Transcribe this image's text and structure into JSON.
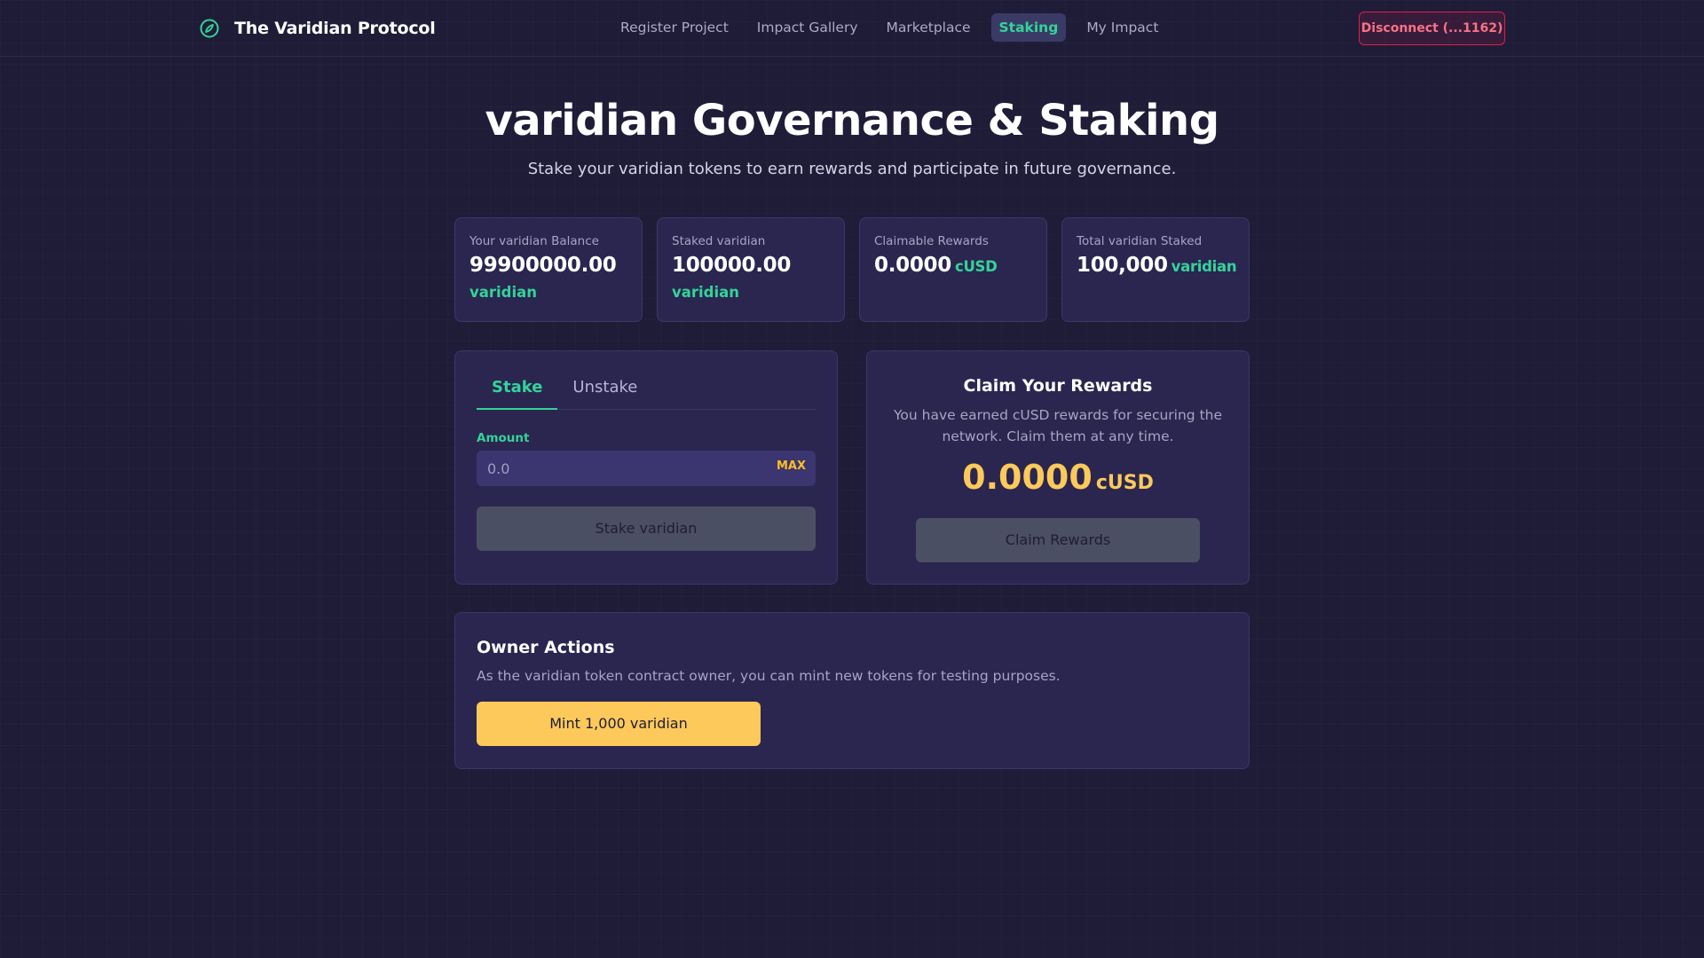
{
  "header": {
    "brand_icon": "leaf-circle-icon",
    "brand_title": "The Varidian Protocol",
    "nav": [
      {
        "label": "Register Project",
        "active": false
      },
      {
        "label": "Impact Gallery",
        "active": false
      },
      {
        "label": "Marketplace",
        "active": false
      },
      {
        "label": "Staking",
        "active": true
      },
      {
        "label": "My Impact",
        "active": false
      }
    ],
    "disconnect_label": "Disconnect (...1162)"
  },
  "hero": {
    "title": "varidian Governance & Staking",
    "subtitle": "Stake your varidian tokens to earn rewards and participate in future governance."
  },
  "stats": [
    {
      "label": "Your varidian Balance",
      "value": "99900000.00",
      "unit": "varidian"
    },
    {
      "label": "Staked varidian",
      "value": "100000.00",
      "unit": "varidian"
    },
    {
      "label": "Claimable Rewards",
      "value": "0.0000",
      "unit": "cUSD"
    },
    {
      "label": "Total varidian Staked",
      "value": "100,000",
      "unit": "varidian"
    }
  ],
  "stake_panel": {
    "tabs": [
      {
        "label": "Stake",
        "active": true
      },
      {
        "label": "Unstake",
        "active": false
      }
    ],
    "amount_label": "Amount",
    "amount_placeholder": "0.0",
    "amount_value": "",
    "max_label": "MAX",
    "submit_label": "Stake varidian"
  },
  "claim_panel": {
    "title": "Claim Your Rewards",
    "description": "You have earned cUSD rewards for securing the network. Claim them at any time.",
    "amount": "0.0000",
    "unit": "cUSD",
    "button_label": "Claim Rewards"
  },
  "owner_panel": {
    "title": "Owner Actions",
    "description": "As the varidian token contract owner, you can mint new tokens for testing purposes.",
    "button_label": "Mint 1,000 varidian"
  },
  "colors": {
    "background": "#1f1c38",
    "card": "#2a2650",
    "accent_green": "#34d399",
    "accent_yellow": "#fcc95a",
    "danger": "#e11d48",
    "disabled_button": "#4b4f63"
  }
}
